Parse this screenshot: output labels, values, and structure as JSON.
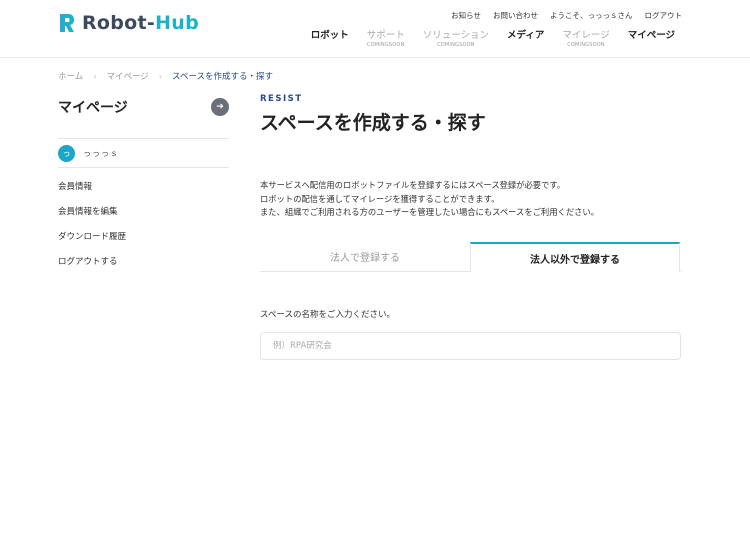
{
  "header": {
    "logo_text_a": "Robot-",
    "logo_text_b": "Hub",
    "util_links": [
      "お知らせ",
      "お問い合わせ",
      "ようこそ、っっっｓさん",
      "ログアウト"
    ],
    "nav": [
      {
        "label": "ロボット",
        "sub": "",
        "disabled": false
      },
      {
        "label": "サポート",
        "sub": "COMINGSOON",
        "disabled": true
      },
      {
        "label": "ソリューション",
        "sub": "COMINGSOON",
        "disabled": true
      },
      {
        "label": "メディア",
        "sub": "",
        "disabled": false
      },
      {
        "label": "マイレージ",
        "sub": "COMINGSOON",
        "disabled": true
      },
      {
        "label": "マイページ",
        "sub": "",
        "disabled": false
      }
    ]
  },
  "breadcrumb": {
    "items": [
      "ホーム",
      "マイページ"
    ],
    "current": "スペースを作成する・探す",
    "separator": "›"
  },
  "sidebar": {
    "title": "マイページ",
    "arrow_icon": "arrow-right-icon",
    "user_initial": "っ",
    "user_name": "っっっｓ",
    "menu": [
      "会員情報",
      "会員情報を編集",
      "ダウンロード履歴",
      "ログアウトする"
    ]
  },
  "main": {
    "eyebrow": "RESIST",
    "title": "スペースを作成する・探す",
    "desc_lines": [
      "本サービスへ配信用のロボットファイルを登録するにはスペース登録が必要です。",
      "ロボットの配信を通してマイレージを獲得することができます。",
      "また、組織でご利用される方のユーザーを管理したい場合にもスペースをご利用ください。"
    ],
    "tabs": [
      {
        "label": "法人で登録する",
        "active": false
      },
      {
        "label": "法人以外で登録する",
        "active": true
      }
    ],
    "field_label": "スペースの名称をご入力ください。",
    "field_placeholder": "例）RPA研究会",
    "field_value": ""
  },
  "colors": {
    "accent": "#1ba7c9",
    "link": "#2a4a8a",
    "arrow_button": "#6b6f78"
  }
}
